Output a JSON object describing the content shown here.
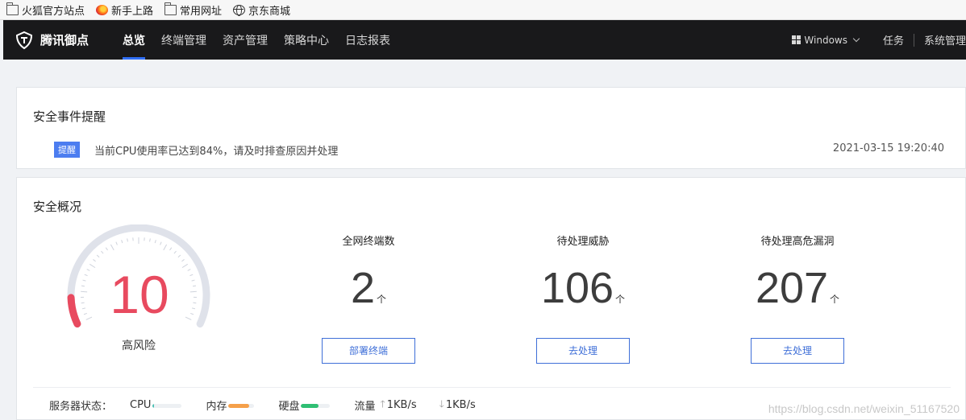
{
  "bookmarks": [
    {
      "label": "火狐官方站点",
      "icon": "folder-icon"
    },
    {
      "label": "新手上路",
      "icon": "firefox-icon"
    },
    {
      "label": "常用网址",
      "icon": "folder-icon"
    },
    {
      "label": "京东商城",
      "icon": "globe-icon"
    }
  ],
  "nav": {
    "brand": "腾讯御点",
    "items": [
      "总览",
      "终端管理",
      "资产管理",
      "策略中心",
      "日志报表"
    ],
    "active": "总览",
    "os": "Windows",
    "tasks": "任务",
    "system": "系统管理"
  },
  "alerts": {
    "title": "安全事件提醒",
    "badge": "提醒",
    "message": "当前CPU使用率已达到84%，请及时排查原因并处理",
    "time": "2021-03-15 19:20:40"
  },
  "overview": {
    "title": "安全概况",
    "risk_score": "10",
    "risk_label": "高风险",
    "stats": [
      {
        "label": "全网终端数",
        "value": "2",
        "unit": "个",
        "button": "部署终端"
      },
      {
        "label": "待处理威胁",
        "value": "106",
        "unit": "个",
        "button": "去处理"
      },
      {
        "label": "待处理高危漏洞",
        "value": "207",
        "unit": "个",
        "button": "去处理"
      }
    ]
  },
  "server_status": {
    "label": "服务器状态：",
    "cpu_label": "CPU",
    "cpu_level": 0.04,
    "mem_label": "内存",
    "mem_level": 0.8,
    "disk_label": "硬盘",
    "disk_level": 0.6,
    "flow_label": "流量",
    "upload": "1KB/s",
    "download": "1KB/s"
  },
  "colors": {
    "accent": "#2f6ef5",
    "risk": "#e84a5f",
    "cpu": "#4bc0b3",
    "mem": "#f5a04a",
    "disk": "#2fbf73"
  },
  "watermark": "https://blog.csdn.net/weixin_51167520"
}
